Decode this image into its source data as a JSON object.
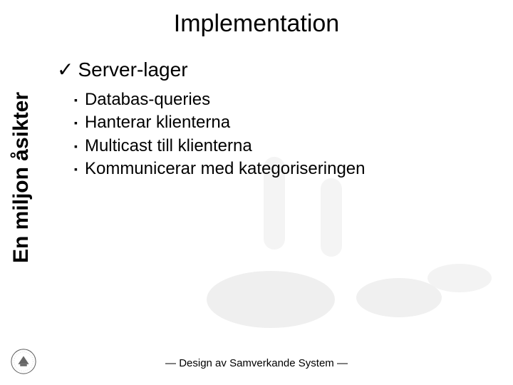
{
  "title": "Implementation",
  "sidebar": {
    "label": "En miljon åsikter"
  },
  "content": {
    "heading_check": "✓",
    "heading": "Server-lager",
    "bullets": [
      "Databas-queries",
      "Hanterar klienterna",
      "Multicast till klienterna",
      "Kommunicerar med kategoriseringen"
    ],
    "bullet_glyph": "▪"
  },
  "footer": "— Design av Samverkande System —",
  "logo": {
    "name": "university-seal-icon"
  }
}
